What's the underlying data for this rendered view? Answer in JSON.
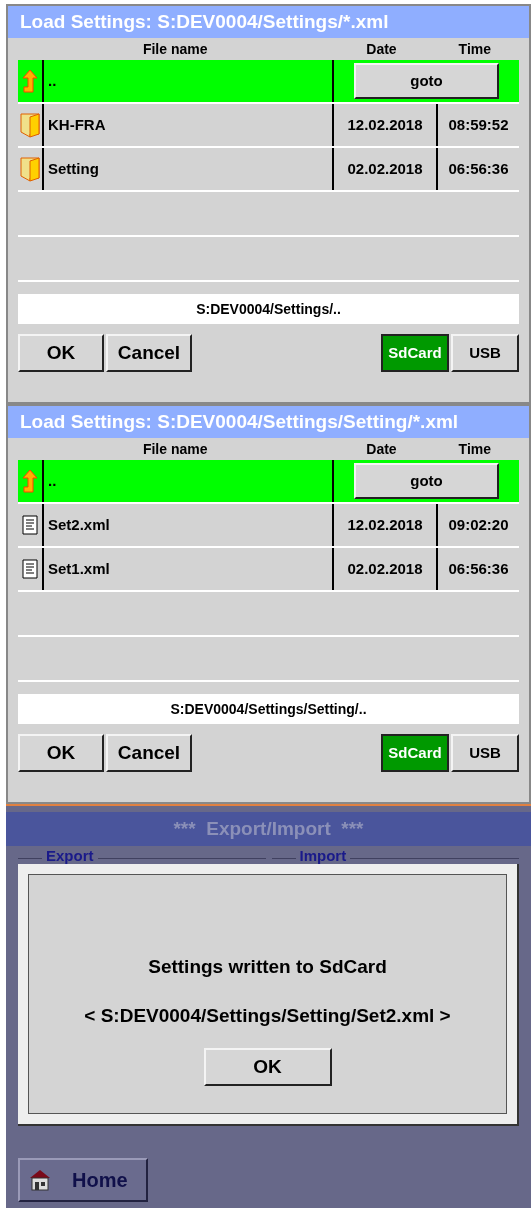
{
  "load_panels": [
    {
      "title": "Load Settings:  S:DEV0004/Settings/*.xml",
      "columns": [
        "File name",
        "Date",
        "Time"
      ],
      "rows": [
        {
          "kind": "up",
          "name": "..",
          "selected": true,
          "action": "goto"
        },
        {
          "kind": "folder",
          "name": "KH-FRA",
          "date": "12.02.2018",
          "time": "08:59:52",
          "selected": false
        },
        {
          "kind": "folder",
          "name": "Setting",
          "date": "02.02.2018",
          "time": "06:56:36",
          "selected": false
        }
      ],
      "path": "S:DEV0004/Settings/..",
      "buttons": [
        "OK",
        "Cancel"
      ],
      "storage": [
        {
          "label": "SdCard",
          "selected": true
        },
        {
          "label": "USB",
          "selected": false
        }
      ]
    },
    {
      "title": "Load Settings:  S:DEV0004/Settings/Setting/*.xml",
      "columns": [
        "File name",
        "Date",
        "Time"
      ],
      "rows": [
        {
          "kind": "up",
          "name": "..",
          "selected": true,
          "action": "goto"
        },
        {
          "kind": "file",
          "name": "Set2.xml",
          "date": "12.02.2018",
          "time": "09:02:20",
          "selected": false
        },
        {
          "kind": "file",
          "name": "Set1.xml",
          "date": "02.02.2018",
          "time": "06:56:36",
          "selected": false
        }
      ],
      "path": "S:DEV0004/Settings/Setting/..",
      "buttons": [
        "OK",
        "Cancel"
      ],
      "storage": [
        {
          "label": "SdCard",
          "selected": true
        },
        {
          "label": "USB",
          "selected": false
        }
      ]
    }
  ],
  "export_import": {
    "title": "***  Export/Import  ***",
    "groups": [
      "Export",
      "Import"
    ],
    "dialog": {
      "message": "Settings written to SdCard",
      "path": "< S:DEV0004/Settings/Setting/Set2.xml >",
      "button": "OK"
    },
    "home_button": "Home"
  }
}
